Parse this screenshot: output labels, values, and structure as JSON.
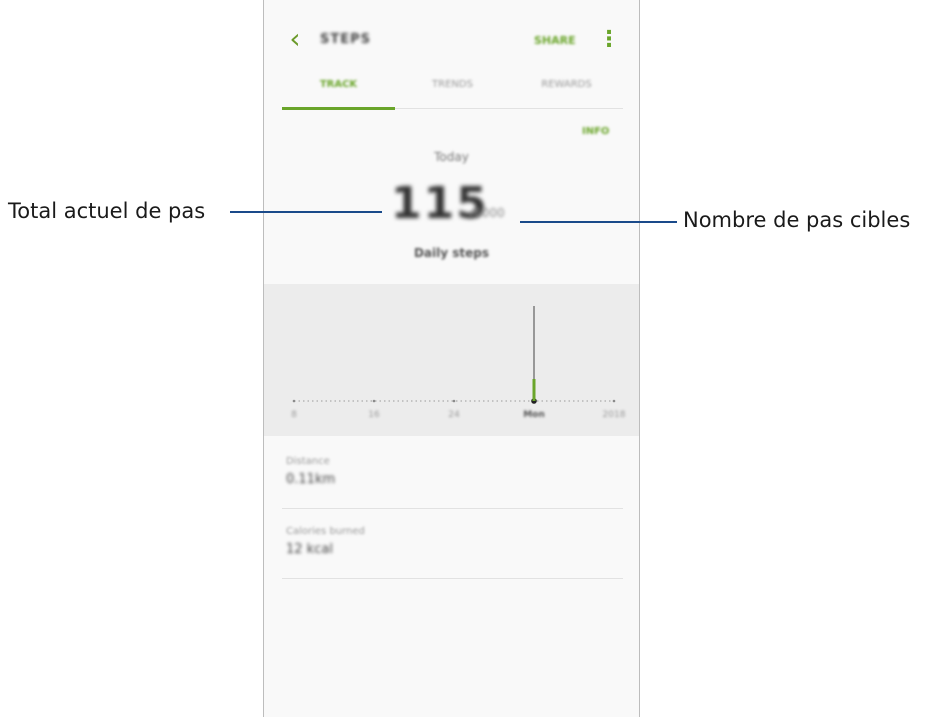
{
  "header": {
    "back_icon": "chevron-left-icon",
    "title": "STEPS",
    "share_label": "SHARE",
    "more_icon": "more-vertical-icon"
  },
  "tabs": [
    {
      "label": "TRACK",
      "active": true
    },
    {
      "label": "TRENDS",
      "active": false
    },
    {
      "label": "REWARDS",
      "active": false
    }
  ],
  "summary": {
    "info_label": "INFO",
    "period": "Today",
    "steps_value": "115",
    "steps_target": "/6000",
    "steps_caption": "Daily steps"
  },
  "chart_data": {
    "type": "bar",
    "categories": [
      "8",
      "16",
      "24",
      "Mon",
      "2018"
    ],
    "selected_category": "Mon",
    "values": [
      0,
      0,
      0,
      115,
      0
    ],
    "accent_color": "#6aa52a"
  },
  "stats": [
    {
      "label": "Distance",
      "value": "0.11km"
    },
    {
      "label": "Calories burned",
      "value": "12 kcal"
    }
  ],
  "callouts": {
    "left": "Total actuel de pas",
    "right": "Nombre de pas cibles"
  },
  "colors": {
    "accent": "#6aa52a",
    "callout_line": "#1a4a8a"
  }
}
